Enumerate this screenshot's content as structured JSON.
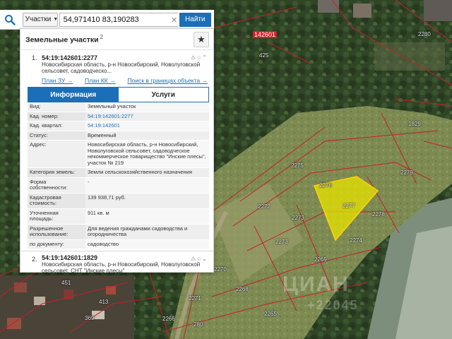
{
  "search": {
    "type_label": "Участки",
    "value": "54,971410 83,190283",
    "find_label": "Найти"
  },
  "panel": {
    "title": "Земельные участки",
    "count": "2"
  },
  "result1": {
    "number": "1.",
    "cad": "54:19:142601:2277",
    "address": "Новосибирская область, р-н Новосибирский, Новолуговской сельсовет, садоводческо...",
    "links": [
      "План ЗУ →",
      "План КК →",
      "Поиск в границах объекта →"
    ]
  },
  "tabs": [
    "Информация",
    "Услуги"
  ],
  "info": [
    {
      "key": "Вид:",
      "value": "Земельный участок"
    },
    {
      "key": "Кад. номер:",
      "value": "54:19:142601:2277"
    },
    {
      "key": "Кад. квартал:",
      "value": "54:19:142601"
    },
    {
      "key": "Статус:",
      "value": "Временный"
    },
    {
      "key": "Адрес:",
      "value": "Новосибирская область, р-н Новосибирский, Новолуговской сельсовет, садоводческое некоммерческое товарищество \"Инские плесы\", участок № 219"
    },
    {
      "key": "Категория земель:",
      "value": "Земли сельскохозяйственного назначения"
    },
    {
      "key": "Форма собственности:",
      "value": "-"
    },
    {
      "key": "Кадастровая стоимость:",
      "value": "139 938,71 руб."
    },
    {
      "key": "Уточненная площадь:",
      "value": "911 кв. м"
    },
    {
      "key": "Разрешенное использование:",
      "value": "Для ведения гражданами садоводства и огородничества"
    },
    {
      "key": "по документу:",
      "value": "садоводство"
    }
  ],
  "result2": {
    "number": "2.",
    "cad": "54:19:142601:1829",
    "address": "Новосибирская область, р-н Новосибирский, Новолуговской сельсовет, СНТ \"Инские плесы\""
  },
  "map": {
    "quarter_label": "142601",
    "plot_labels": [
      "2280",
      "425",
      "1829",
      "2275",
      "2279",
      "2276",
      "2277",
      "2272",
      "2273",
      "2278",
      "2273",
      "2274",
      "2269",
      "2270",
      "2268",
      "2271",
      "2265",
      "2266",
      "280",
      "451",
      "413",
      "369"
    ],
    "watermark": [
      "ЦИАН",
      "+22045"
    ]
  }
}
